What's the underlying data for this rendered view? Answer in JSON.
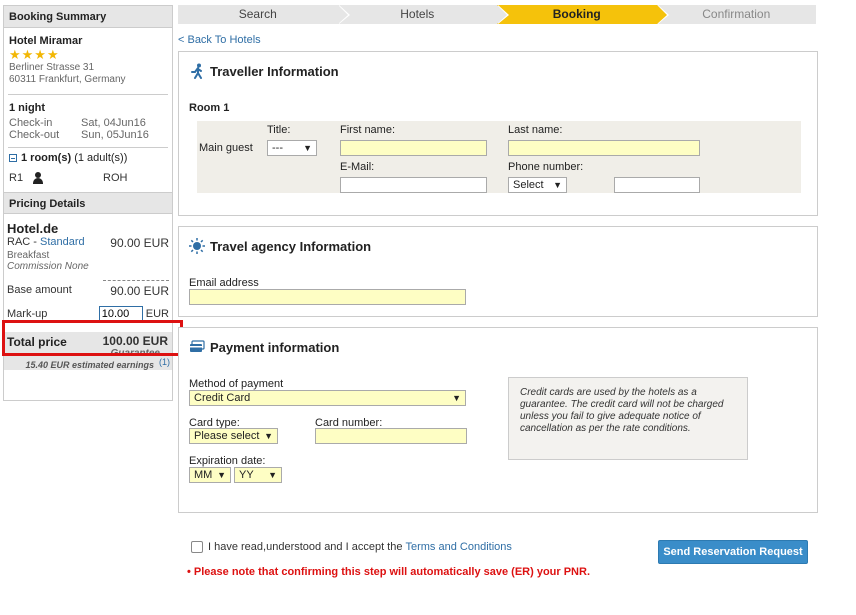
{
  "sidebar": {
    "booking_summary_title": "Booking Summary",
    "hotel_name": "Hotel Miramar",
    "star_count": 4,
    "stars": "★★★★",
    "address_line1": "Berliner Strasse 31",
    "address_line2": "60311 Frankfurt, Germany",
    "nights": "1 night",
    "checkin_label": "Check-in",
    "checkin_value": "Sat, 04Jun16",
    "checkout_label": "Check-out",
    "checkout_value": "Sun, 05Jun16",
    "rooms_bold": "1 room(s)",
    "rooms_rest": "(1 adult(s))",
    "room_id": "R1",
    "room_code": "ROH",
    "pricing_title": "Pricing Details",
    "provider": "Hotel.de",
    "rate_prefix": "RAC - ",
    "rate_name": "Standard",
    "rate_amount": "90.00 EUR",
    "breakfast": "Breakfast",
    "commission": "Commission None",
    "base_label": "Base amount",
    "base_amount": "90.00 EUR",
    "markup_label": "Mark-up",
    "markup_value": "10.00",
    "markup_currency": "EUR",
    "total_label": "Total price",
    "total_amount": "100.00 EUR",
    "guarantee": "Guarantee",
    "earnings": "15.40 EUR estimated earnings",
    "earnings_note": "(1)"
  },
  "steps": [
    {
      "label": "Search",
      "state": "done"
    },
    {
      "label": "Hotels",
      "state": "done"
    },
    {
      "label": "Booking",
      "state": "active"
    },
    {
      "label": "Confirmation",
      "state": "pending"
    }
  ],
  "back_link": "< Back To Hotels",
  "traveller": {
    "title": "Traveller Information",
    "room_label": "Room 1",
    "main_guest_label": "Main guest",
    "title_label": "Title:",
    "title_value": "---",
    "first_name_label": "First name:",
    "last_name_label": "Last name:",
    "email_label": "E-Mail:",
    "phone_label": "Phone number:",
    "phone_select": "Select"
  },
  "agency": {
    "title": "Travel agency Information",
    "email_label": "Email address"
  },
  "payment": {
    "title": "Payment information",
    "method_label": "Method of payment",
    "method_value": "Credit Card",
    "card_type_label": "Card type:",
    "card_type_value": "Please select",
    "card_number_label": "Card number:",
    "expiration_label": "Expiration date:",
    "month_value": "MM",
    "year_value": "YY",
    "info_text": "Credit cards are used by the hotels as a guarantee. The credit card will not be charged unless you fail to give adequate notice of cancellation as per the rate conditions."
  },
  "footer": {
    "terms_text": "I have read,understood and I accept the",
    "terms_link": "Terms and Conditions",
    "send_button": "Send Reservation Request",
    "warning": "• Please note that confirming this step will automatically save (ER) your PNR."
  },
  "colors": {
    "accent": "#f5c20b",
    "link": "#2f6ea5",
    "button": "#3a8dc9",
    "warning": "#dd1111",
    "field_highlight": "#fefec4"
  }
}
